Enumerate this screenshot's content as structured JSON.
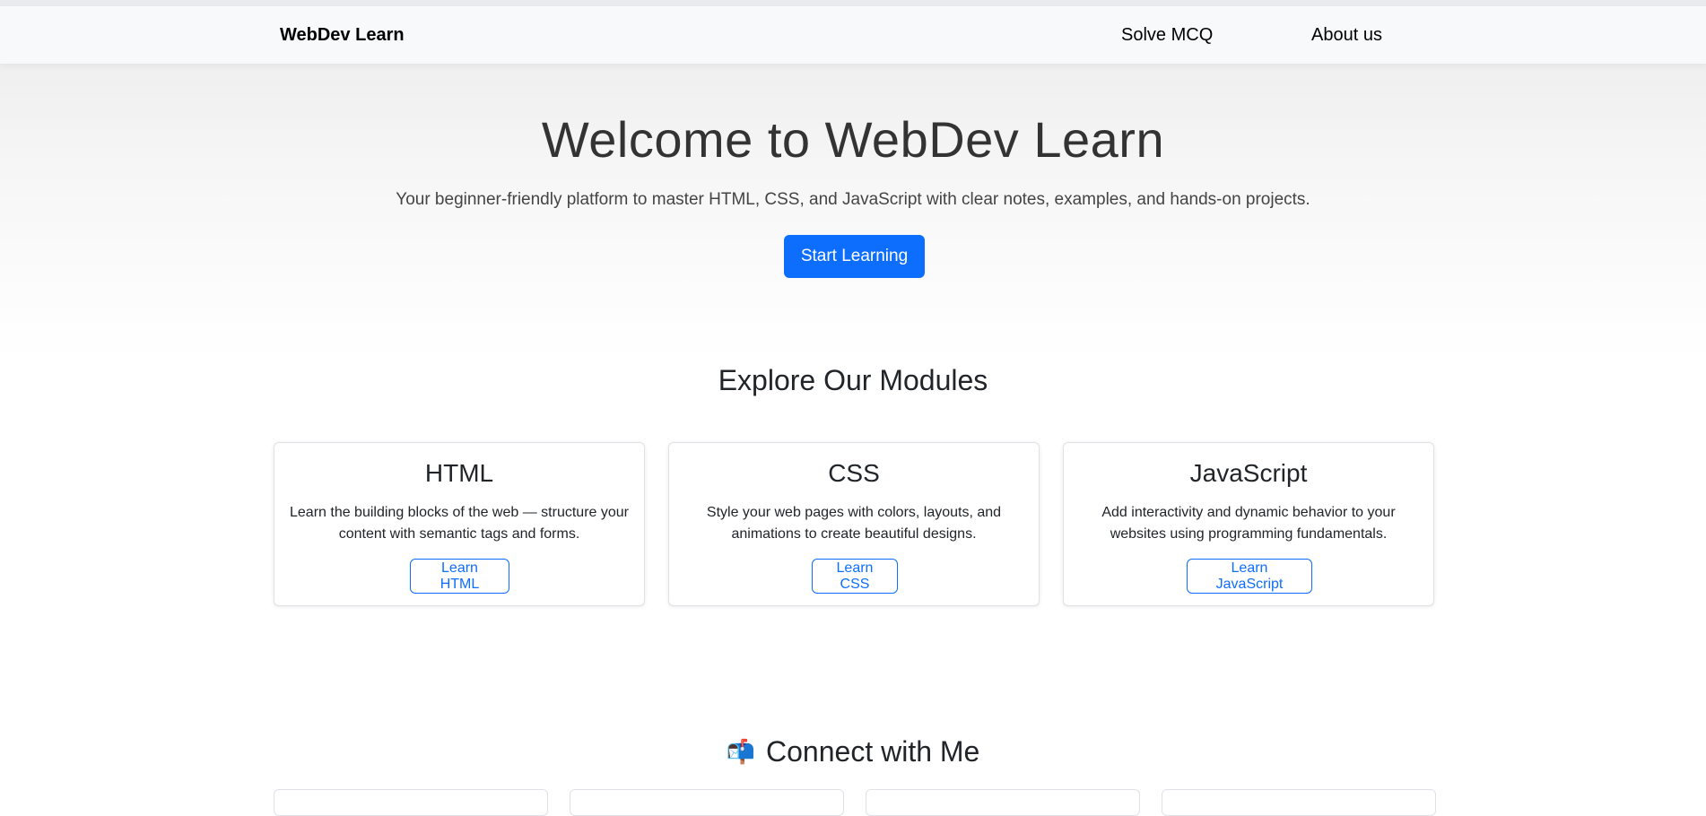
{
  "navbar": {
    "brand": "WebDev Learn",
    "links": [
      "Solve MCQ",
      "About us"
    ]
  },
  "hero": {
    "title": "Welcome to WebDev Learn",
    "subtitle": "Your beginner-friendly platform to master HTML, CSS, and JavaScript with clear notes, examples, and hands-on projects.",
    "cta_label": "Start Learning"
  },
  "modules": {
    "heading": "Explore Our Modules",
    "cards": [
      {
        "title": "HTML",
        "text": "Learn the building blocks of the web — structure your content with semantic tags and forms.",
        "button": "Learn HTML"
      },
      {
        "title": "CSS",
        "text": "Style your web pages with colors, layouts, and animations to create beautiful designs.",
        "button": "Learn CSS"
      },
      {
        "title": "JavaScript",
        "text": "Add interactivity and dynamic behavior to your websites using programming fundamentals.",
        "button": "Learn JavaScript"
      }
    ]
  },
  "connect": {
    "icon": "mailbox-icon",
    "icon_glyph": "📬",
    "heading": "Connect with Me"
  },
  "colors": {
    "primary": "#0d6efd",
    "navbar_bg": "#f8f9fa",
    "text": "#212529"
  }
}
